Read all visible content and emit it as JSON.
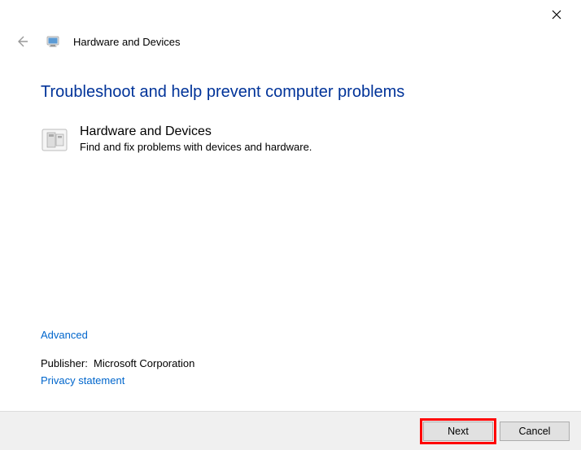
{
  "window": {
    "title": "Hardware and Devices"
  },
  "heading": "Troubleshoot and help prevent computer problems",
  "troubleshooter": {
    "title": "Hardware and Devices",
    "description": "Find and fix problems with devices and hardware."
  },
  "links": {
    "advanced": "Advanced",
    "privacy": "Privacy statement"
  },
  "publisher": {
    "label": "Publisher:",
    "value": "Microsoft Corporation"
  },
  "buttons": {
    "next": "Next",
    "cancel": "Cancel"
  }
}
